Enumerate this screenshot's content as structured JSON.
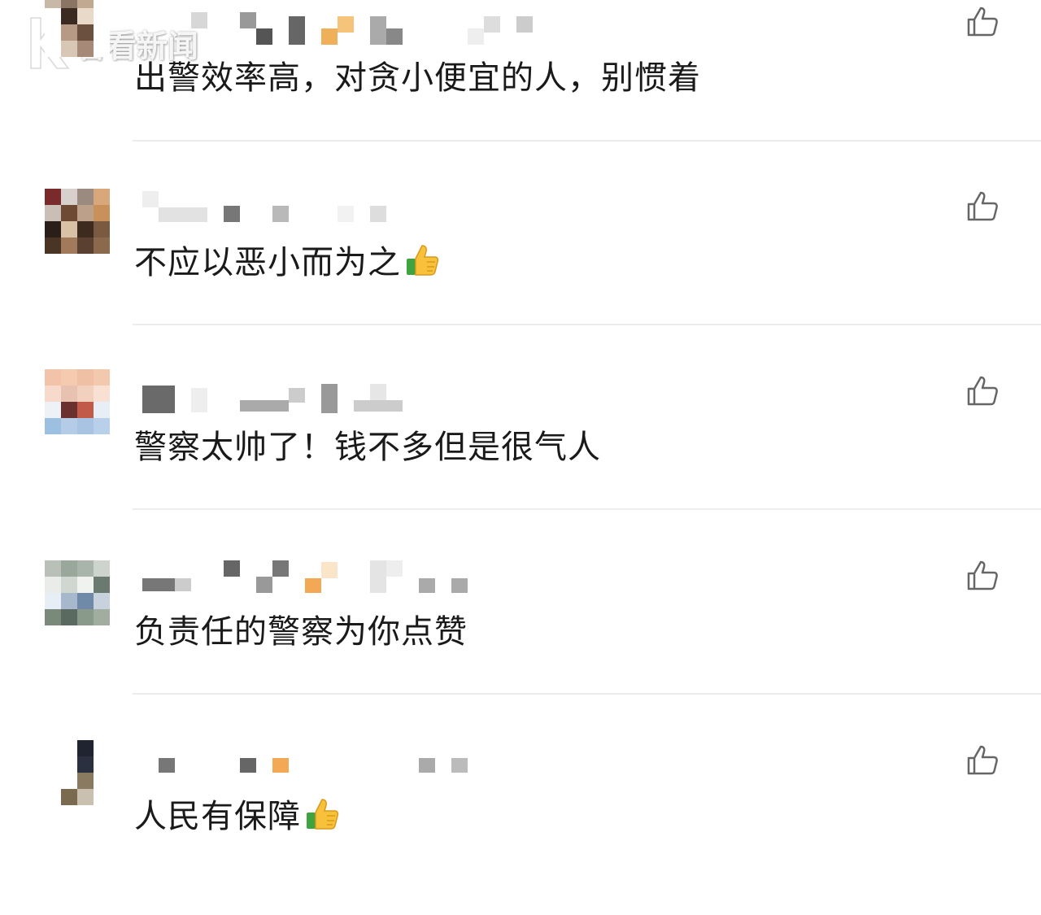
{
  "watermark": {
    "text": "看看新闻",
    "logo_letter": "K"
  },
  "comments": [
    {
      "username": "",
      "text": "出警效率高，对贪小便宜的人，别惯着",
      "has_emoji": false
    },
    {
      "username": "",
      "text": "不应以恶小而为之",
      "has_emoji": true,
      "emoji": "thumbs-up-icon"
    },
    {
      "username": "",
      "text": "警察太帅了！钱不多但是很气人",
      "has_emoji": false
    },
    {
      "username": "",
      "text": "负责任的警察为你点赞",
      "has_emoji": false
    },
    {
      "username": "",
      "text": "人民有保障",
      "has_emoji": true,
      "emoji": "thumbs-up-icon"
    }
  ],
  "colors": {
    "text": "#1a1a1a",
    "divider": "#ececec",
    "like_icon": "#666666",
    "emoji_yellow": "#f7c13c",
    "emoji_green": "#3fa33f"
  }
}
